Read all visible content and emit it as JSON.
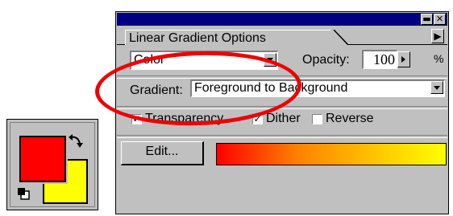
{
  "swatch": {
    "foreground_color": "#ff0000",
    "background_color": "#ffff00",
    "swap_icon": "swap-arrows-icon",
    "default_icon": "default-colors-icon"
  },
  "palette": {
    "titlebar": {
      "minimize_label": "▬",
      "close_label": "✕"
    },
    "tab_label": "Linear Gradient Options",
    "menu_arrow": "▶",
    "color_dropdown": {
      "value": "Color"
    },
    "opacity": {
      "label": "Opacity:",
      "value": "100",
      "unit": "%"
    },
    "gradient": {
      "label": "Gradient:",
      "value": "Foreground to Background"
    },
    "checkboxes": [
      {
        "label": "Transparency",
        "checked": true
      },
      {
        "label": "Dither",
        "checked": true
      },
      {
        "label": "Reverse",
        "checked": false
      }
    ],
    "edit_button": "Edit...",
    "gradient_preview": {
      "start": "#ff0000",
      "end": "#ffff00"
    },
    "annotation_color": "#ee0000"
  }
}
